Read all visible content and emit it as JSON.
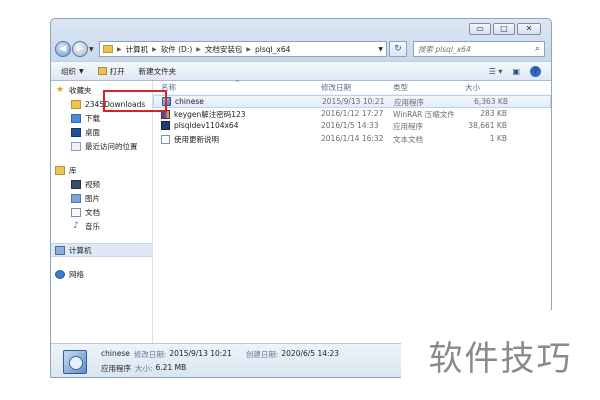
{
  "window": {
    "buttons": [
      "▭",
      "□",
      "✕"
    ]
  },
  "address": {
    "segments": [
      "计算机",
      "软件 (D:)",
      "文档安装包",
      "plsql_x64"
    ]
  },
  "search": {
    "placeholder": "搜索 plsql_x64"
  },
  "toolbar": {
    "organize": "组织",
    "open": "打开",
    "new_folder": "新建文件夹"
  },
  "nav": {
    "favorites": "收藏夹",
    "fav_items": [
      "2345Downloads",
      "下载",
      "桌面",
      "最近访问的位置"
    ],
    "libraries": "库",
    "lib_items": [
      "视频",
      "图片",
      "文档",
      "音乐"
    ],
    "computer": "计算机",
    "network": "网络"
  },
  "columns": {
    "name": "名称",
    "date": "修改日期",
    "type": "类型",
    "size": "大小"
  },
  "files": [
    {
      "name": "chinese",
      "date": "2015/9/13 10:21",
      "type": "应用程序",
      "size": "6,363 KB",
      "icon": "app"
    },
    {
      "name": "keygen解注密码123",
      "date": "2016/1/12 17:27",
      "type": "WinRAR 压缩文件",
      "size": "283 KB",
      "icon": "rar"
    },
    {
      "name": "plsqldev1104x64",
      "date": "2016/1/5 14:33",
      "type": "应用程序",
      "size": "38,661 KB",
      "icon": "plsql"
    },
    {
      "name": "使用更新说明",
      "date": "2016/1/14 16:32",
      "type": "文本文档",
      "size": "1 KB",
      "icon": "txt"
    }
  ],
  "details": {
    "name": "chinese",
    "modified_label": "修改日期:",
    "modified": "2015/9/13 10:21",
    "created_label": "创建日期:",
    "created": "2020/6/5 14:23",
    "type": "应用程序",
    "size_label": "大小:",
    "size": "6.21 MB"
  },
  "watermark": "软件技巧",
  "colors": {
    "highlight": "#d6222a",
    "selection": "#e2ecf9"
  }
}
